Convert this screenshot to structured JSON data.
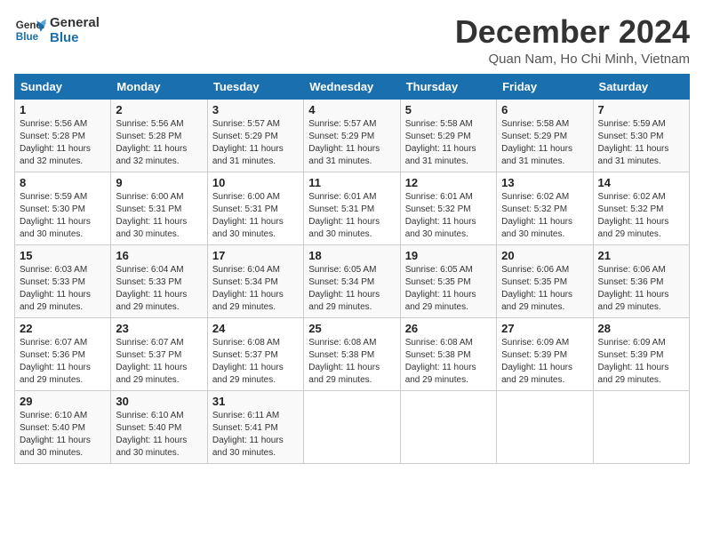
{
  "logo": {
    "line1": "General",
    "line2": "Blue"
  },
  "title": "December 2024",
  "subtitle": "Quan Nam, Ho Chi Minh, Vietnam",
  "weekdays": [
    "Sunday",
    "Monday",
    "Tuesday",
    "Wednesday",
    "Thursday",
    "Friday",
    "Saturday"
  ],
  "weeks": [
    [
      {
        "day": "1",
        "sunrise": "5:56 AM",
        "sunset": "5:28 PM",
        "daylight": "11 hours and 32 minutes."
      },
      {
        "day": "2",
        "sunrise": "5:56 AM",
        "sunset": "5:28 PM",
        "daylight": "11 hours and 32 minutes."
      },
      {
        "day": "3",
        "sunrise": "5:57 AM",
        "sunset": "5:29 PM",
        "daylight": "11 hours and 31 minutes."
      },
      {
        "day": "4",
        "sunrise": "5:57 AM",
        "sunset": "5:29 PM",
        "daylight": "11 hours and 31 minutes."
      },
      {
        "day": "5",
        "sunrise": "5:58 AM",
        "sunset": "5:29 PM",
        "daylight": "11 hours and 31 minutes."
      },
      {
        "day": "6",
        "sunrise": "5:58 AM",
        "sunset": "5:29 PM",
        "daylight": "11 hours and 31 minutes."
      },
      {
        "day": "7",
        "sunrise": "5:59 AM",
        "sunset": "5:30 PM",
        "daylight": "11 hours and 31 minutes."
      }
    ],
    [
      {
        "day": "8",
        "sunrise": "5:59 AM",
        "sunset": "5:30 PM",
        "daylight": "11 hours and 30 minutes."
      },
      {
        "day": "9",
        "sunrise": "6:00 AM",
        "sunset": "5:31 PM",
        "daylight": "11 hours and 30 minutes."
      },
      {
        "day": "10",
        "sunrise": "6:00 AM",
        "sunset": "5:31 PM",
        "daylight": "11 hours and 30 minutes."
      },
      {
        "day": "11",
        "sunrise": "6:01 AM",
        "sunset": "5:31 PM",
        "daylight": "11 hours and 30 minutes."
      },
      {
        "day": "12",
        "sunrise": "6:01 AM",
        "sunset": "5:32 PM",
        "daylight": "11 hours and 30 minutes."
      },
      {
        "day": "13",
        "sunrise": "6:02 AM",
        "sunset": "5:32 PM",
        "daylight": "11 hours and 30 minutes."
      },
      {
        "day": "14",
        "sunrise": "6:02 AM",
        "sunset": "5:32 PM",
        "daylight": "11 hours and 29 minutes."
      }
    ],
    [
      {
        "day": "15",
        "sunrise": "6:03 AM",
        "sunset": "5:33 PM",
        "daylight": "11 hours and 29 minutes."
      },
      {
        "day": "16",
        "sunrise": "6:04 AM",
        "sunset": "5:33 PM",
        "daylight": "11 hours and 29 minutes."
      },
      {
        "day": "17",
        "sunrise": "6:04 AM",
        "sunset": "5:34 PM",
        "daylight": "11 hours and 29 minutes."
      },
      {
        "day": "18",
        "sunrise": "6:05 AM",
        "sunset": "5:34 PM",
        "daylight": "11 hours and 29 minutes."
      },
      {
        "day": "19",
        "sunrise": "6:05 AM",
        "sunset": "5:35 PM",
        "daylight": "11 hours and 29 minutes."
      },
      {
        "day": "20",
        "sunrise": "6:06 AM",
        "sunset": "5:35 PM",
        "daylight": "11 hours and 29 minutes."
      },
      {
        "day": "21",
        "sunrise": "6:06 AM",
        "sunset": "5:36 PM",
        "daylight": "11 hours and 29 minutes."
      }
    ],
    [
      {
        "day": "22",
        "sunrise": "6:07 AM",
        "sunset": "5:36 PM",
        "daylight": "11 hours and 29 minutes."
      },
      {
        "day": "23",
        "sunrise": "6:07 AM",
        "sunset": "5:37 PM",
        "daylight": "11 hours and 29 minutes."
      },
      {
        "day": "24",
        "sunrise": "6:08 AM",
        "sunset": "5:37 PM",
        "daylight": "11 hours and 29 minutes."
      },
      {
        "day": "25",
        "sunrise": "6:08 AM",
        "sunset": "5:38 PM",
        "daylight": "11 hours and 29 minutes."
      },
      {
        "day": "26",
        "sunrise": "6:08 AM",
        "sunset": "5:38 PM",
        "daylight": "11 hours and 29 minutes."
      },
      {
        "day": "27",
        "sunrise": "6:09 AM",
        "sunset": "5:39 PM",
        "daylight": "11 hours and 29 minutes."
      },
      {
        "day": "28",
        "sunrise": "6:09 AM",
        "sunset": "5:39 PM",
        "daylight": "11 hours and 29 minutes."
      }
    ],
    [
      {
        "day": "29",
        "sunrise": "6:10 AM",
        "sunset": "5:40 PM",
        "daylight": "11 hours and 30 minutes."
      },
      {
        "day": "30",
        "sunrise": "6:10 AM",
        "sunset": "5:40 PM",
        "daylight": "11 hours and 30 minutes."
      },
      {
        "day": "31",
        "sunrise": "6:11 AM",
        "sunset": "5:41 PM",
        "daylight": "11 hours and 30 minutes."
      },
      null,
      null,
      null,
      null
    ]
  ]
}
